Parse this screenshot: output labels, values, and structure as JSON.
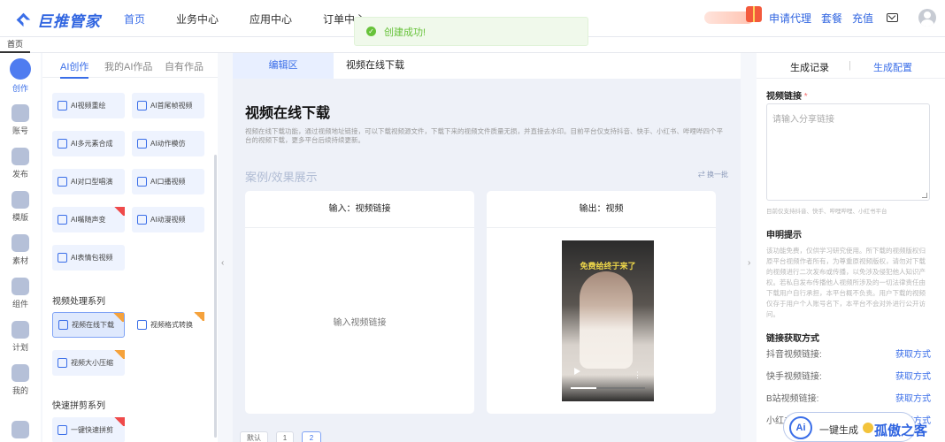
{
  "header": {
    "logo_text": "巨推管家",
    "nav": [
      "首页",
      "业务中心",
      "应用中心",
      "订单中心"
    ],
    "active_nav": "首页",
    "links": [
      "申请代理",
      "套餐",
      "充值"
    ]
  },
  "toast": {
    "message": "创建成功!"
  },
  "tabstrip": {
    "tabs": [
      "首页"
    ]
  },
  "sidebar": {
    "items": [
      {
        "label": "创作",
        "icon": "create-icon"
      },
      {
        "label": "账号",
        "icon": "account-icon"
      },
      {
        "label": "发布",
        "icon": "publish-icon"
      },
      {
        "label": "模版",
        "icon": "template-icon"
      },
      {
        "label": "素材",
        "icon": "material-icon"
      },
      {
        "label": "组件",
        "icon": "component-icon"
      },
      {
        "label": "计划",
        "icon": "plan-icon"
      },
      {
        "label": "我的",
        "icon": "user-icon"
      }
    ]
  },
  "tools": {
    "tabs": [
      "AI创作",
      "我的AI作品",
      "自有作品"
    ],
    "ai_cards": [
      "AI视频重绘",
      "AI首尾帧视频",
      "AI多元素合成",
      "AI动作模仿",
      "AI对口型唱演",
      "AI口播视频",
      "AI嘴随声变",
      "AI动漫视频",
      "AI表情包视频"
    ],
    "video_section_title": "视频处理系列",
    "video_cards": [
      "视频在线下载",
      "视频格式转换",
      "视频大小压缩"
    ],
    "quick_section_title": "快速拼剪系列",
    "quick_cards": [
      "一键快速拼剪"
    ]
  },
  "editor": {
    "tab_edit": "编辑区",
    "tab_current": "视频在线下载",
    "title": "视频在线下载",
    "desc": "视频在线下载功能，通过视频地址链接，可以下载视频源文件，下载下来的视频文件质量无损，并直接去水印。目前平台仅支持抖音、快手、小红书、哔哩哔四个平台的视频下载，更多平台后续持续更新。",
    "examples_title": "案例/效果展示",
    "swap_label": "换一批",
    "input_header": "输入：视频链接",
    "input_body": "输入视频链接",
    "output_header": "输出：视频",
    "video_caption": "免费给终于来了",
    "pager": [
      "默认",
      "1",
      "2"
    ]
  },
  "right_panel": {
    "tabs": [
      "生成记录",
      "生成配置"
    ],
    "link_label": "视频链接",
    "link_placeholder": "请输入分享链接",
    "link_hint": "目前仅支持抖音、快手、哔哩哔哩、小红书平台",
    "notice_title": "申明提示",
    "notice_text": "该功能免费，仅供学习研究使用。所下载的视频版权归原平台视频作者所有，为尊重原视频版权，请勿对下载的视频进行二次发布或传播，以免涉及侵犯他人知识产权。若私自发布传播他人视频所涉及的一切法律责任由下载用户自行承担，本平台概不负责。用户下载的视频仅存于用户个人账号名下，本平台不会对外进行公开访问。",
    "how_title": "链接获取方式",
    "how_rows": [
      {
        "label": "抖音视频链接:",
        "action": "获取方式"
      },
      {
        "label": "快手视频链接:",
        "action": "获取方式"
      },
      {
        "label": "B站视频链接:",
        "action": "获取方式"
      },
      {
        "label": "小红书视频链接:",
        "action": "获取方式"
      }
    ]
  },
  "floating": {
    "ai_badge": "Ai",
    "label": "一键生成"
  },
  "watermark": "孤傲之客",
  "colors": {
    "accent": "#3a6ee8",
    "success": "#67c23a",
    "danger": "#f56c6c"
  }
}
